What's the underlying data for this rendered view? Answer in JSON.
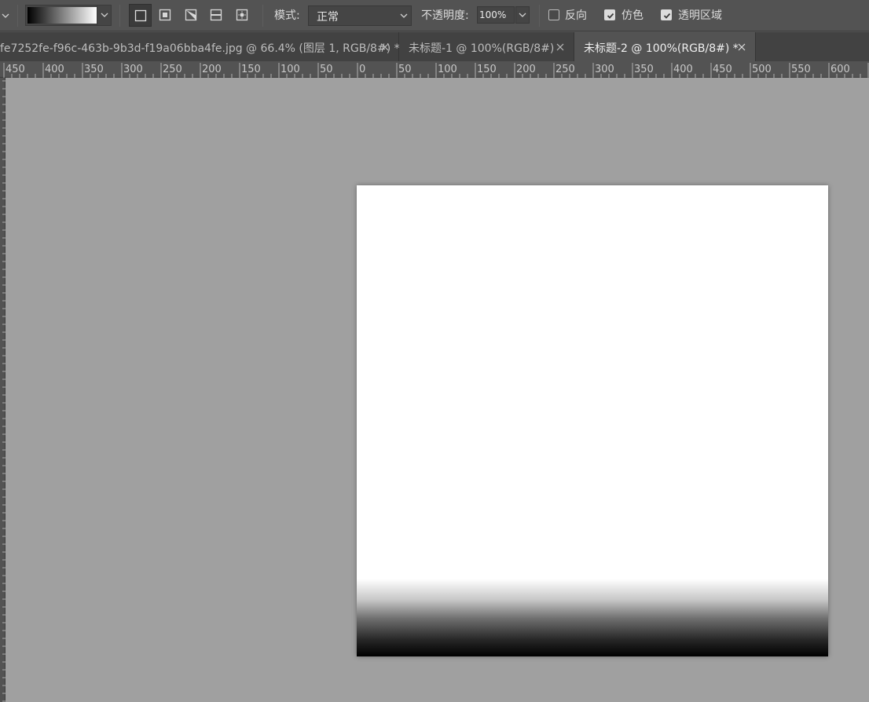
{
  "options_bar": {
    "tool_preset_icon": "chevron-down-icon",
    "gradient_picker": {
      "start_color": "#000000",
      "end_color": "#ffffff",
      "dropdown_icon": "chevron-down-icon"
    },
    "gradient_types": [
      {
        "name": "linear-gradient",
        "icon": "linear-gradient-icon",
        "selected": true
      },
      {
        "name": "radial-gradient",
        "icon": "radial-gradient-icon",
        "selected": false
      },
      {
        "name": "angle-gradient",
        "icon": "angle-gradient-icon",
        "selected": false
      },
      {
        "name": "reflected-gradient",
        "icon": "reflected-gradient-icon",
        "selected": false
      },
      {
        "name": "diamond-gradient",
        "icon": "diamond-gradient-icon",
        "selected": false
      }
    ],
    "mode_label": "模式:",
    "mode_value": "正常",
    "opacity_label": "不透明度:",
    "opacity_value": "100%",
    "reverse_label": "反向",
    "reverse_checked": false,
    "dither_label": "仿色",
    "dither_checked": true,
    "transparency_label": "透明区域",
    "transparency_checked": true
  },
  "tabs": [
    {
      "label": "fe7252fe-f96c-463b-9b3d-f19a06bba4fe.jpg @ 66.4% (图层 1, RGB/8#) *",
      "active": false,
      "close_icon": "close-icon"
    },
    {
      "label": "未标题-1 @ 100%(RGB/8#)",
      "active": false,
      "close_icon": "close-icon"
    },
    {
      "label": "未标题-2 @ 100%(RGB/8#) *",
      "active": true,
      "close_icon": "close-icon"
    }
  ],
  "ruler": {
    "labels": [
      "450",
      "400",
      "350",
      "300",
      "250",
      "200",
      "150",
      "100",
      "50",
      "0",
      "50",
      "100",
      "150",
      "200",
      "250",
      "300",
      "350",
      "400",
      "450",
      "500",
      "550",
      "600"
    ]
  },
  "canvas": {
    "background": "#a0a0a0",
    "document_fill_top": "#ffffff",
    "document_fill_bottom": "#000000",
    "gradient_fill_start_fraction": 0.835
  }
}
